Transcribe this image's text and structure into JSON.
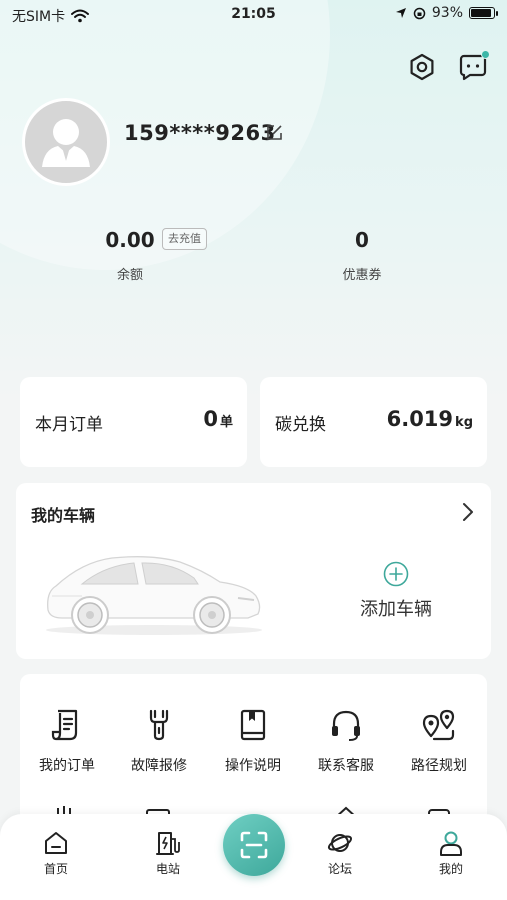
{
  "status_bar": {
    "carrier": "无SIM卡",
    "time": "21:05",
    "battery": "93%",
    "battery_level": 0.93
  },
  "profile": {
    "phone": "159****9263"
  },
  "stats": {
    "balance_value": "0.00",
    "balance_label": "余额",
    "recharge_label": "去充值",
    "coupon_value": "0",
    "coupon_label": "优惠券"
  },
  "summary": {
    "orders_label": "本月订单",
    "orders_value": "0",
    "orders_unit": "单",
    "carbon_label": "碳兑换",
    "carbon_value": "6.019",
    "carbon_unit": "kg"
  },
  "vehicle": {
    "title": "我的车辆",
    "add_label": "添加车辆"
  },
  "menu": {
    "items": [
      {
        "label": "我的订单",
        "icon": "order-icon"
      },
      {
        "label": "故障报修",
        "icon": "wrench-icon"
      },
      {
        "label": "操作说明",
        "icon": "manual-icon"
      },
      {
        "label": "联系客服",
        "icon": "headset-icon"
      },
      {
        "label": "路径规划",
        "icon": "route-icon"
      }
    ]
  },
  "tabbar": {
    "items": [
      {
        "label": "首页",
        "icon": "home-icon"
      },
      {
        "label": "电站",
        "icon": "station-icon"
      },
      {
        "label": "论坛",
        "icon": "planet-icon"
      },
      {
        "label": "我的",
        "icon": "user-icon"
      }
    ]
  },
  "colors": {
    "accent": "#3ea89b",
    "header_bg": "#dff3f1",
    "page_bg": "#f3f5f5"
  }
}
